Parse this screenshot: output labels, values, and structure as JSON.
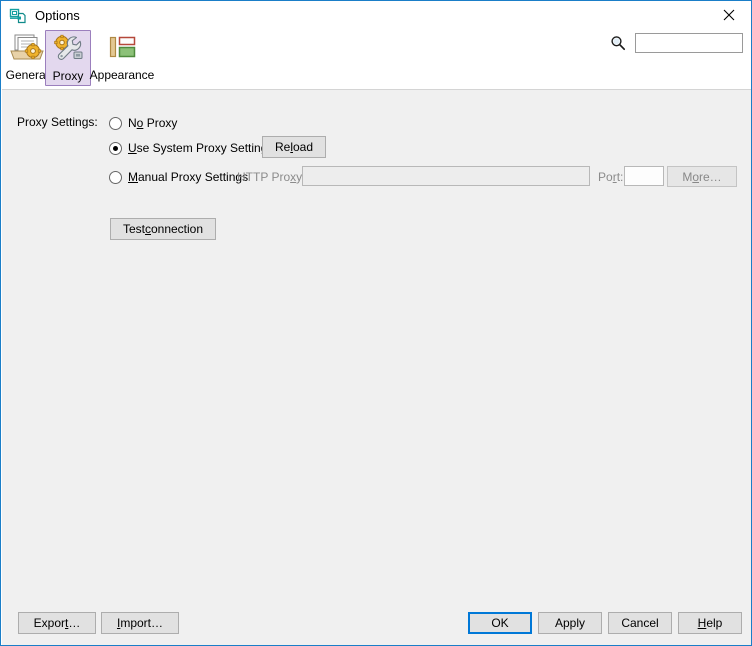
{
  "window": {
    "title": "Options",
    "icon": "options-properties-icon",
    "close_label": "✕",
    "accent_color": "#1a7ec8"
  },
  "toolbar": {
    "items": [
      {
        "label": "General",
        "icon": "general-documents-gear-icon",
        "selected": false
      },
      {
        "label": "Proxy",
        "icon": "proxy-gear-wrench-icon",
        "selected": true
      },
      {
        "label": "Appearance",
        "icon": "appearance-layout-icon",
        "selected": false
      }
    ],
    "search": {
      "icon": "search-icon",
      "value": "",
      "placeholder": ""
    }
  },
  "main": {
    "group_label": "Proxy Settings:",
    "options": [
      {
        "id": "no-proxy",
        "label_pre": "N",
        "label_mnemonic": "o",
        "label_post": " Proxy",
        "label": "No Proxy",
        "checked": false
      },
      {
        "id": "use-system-proxy-settings",
        "label_pre": "",
        "label_mnemonic": "U",
        "label_post": "se System Proxy Settings",
        "label": "Use System Proxy Settings",
        "checked": true
      },
      {
        "id": "manual-proxy-settings",
        "label_pre": "",
        "label_mnemonic": "M",
        "label_post": "anual Proxy Settings",
        "label": "Manual Proxy Settings",
        "checked": false
      }
    ],
    "reload_button": {
      "pre": "Re",
      "mnemonic": "l",
      "post": "oad",
      "label": "Reload",
      "enabled": true
    },
    "http_proxy": {
      "label_pre": "HTTP Pro",
      "label_mnemonic": "x",
      "label_post": "y:",
      "label": "HTTP Proxy:",
      "value": "",
      "placeholder": "",
      "enabled": false
    },
    "port": {
      "label_pre": "Po",
      "label_mnemonic": "r",
      "label_post": "t:",
      "label": "Port:",
      "value": "",
      "placeholder": "",
      "enabled": false
    },
    "more_button": {
      "pre": "M",
      "mnemonic": "o",
      "post": "re…",
      "label": "More…",
      "enabled": false
    },
    "test_connection_button": {
      "pre": "Test ",
      "mnemonic": "c",
      "post": "onnection",
      "label": "Test connection",
      "enabled": true
    }
  },
  "footer": {
    "buttons": [
      {
        "id": "export",
        "pre": "Expor",
        "mnemonic": "t",
        "post": "…",
        "label": "Export…",
        "default": false
      },
      {
        "id": "import",
        "pre": "",
        "mnemonic": "I",
        "post": "mport…",
        "label": "Import…",
        "default": false
      },
      {
        "id": "ok",
        "pre": "OK",
        "mnemonic": "",
        "post": "",
        "label": "OK",
        "default": true
      },
      {
        "id": "apply",
        "pre": "Apply",
        "mnemonic": "",
        "post": "",
        "label": "Apply",
        "default": false
      },
      {
        "id": "cancel",
        "pre": "Cancel",
        "mnemonic": "",
        "post": "",
        "label": "Cancel",
        "default": false
      },
      {
        "id": "help",
        "pre": "",
        "mnemonic": "H",
        "post": "elp",
        "label": "Help",
        "default": false
      }
    ]
  }
}
